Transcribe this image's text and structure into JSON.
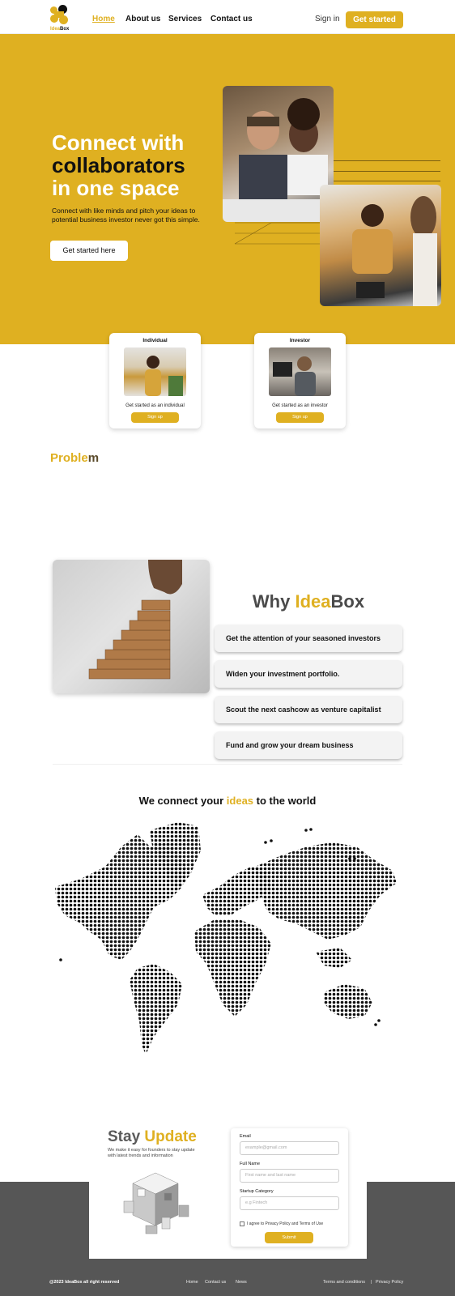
{
  "brand": {
    "name_part1": "Idea",
    "name_part2": "Box",
    "accent": "#dfb021"
  },
  "nav": {
    "links": [
      "Home",
      "About us",
      "Services",
      "Contact us"
    ],
    "signin": "Sign in",
    "cta": "Get started"
  },
  "hero": {
    "title_line1": "Connect with",
    "title_line2": "collaborators",
    "title_line3": "in one space",
    "subtitle": "Connect with like minds and pitch your ideas to potential business investor never got this simple.",
    "cta": "Get started here"
  },
  "cards": [
    {
      "title": "Individual",
      "desc": "Get started as an individual",
      "button": "Sign up"
    },
    {
      "title": "Investor",
      "desc": "Get started as an investor",
      "button": "Sign up"
    }
  ],
  "problem": {
    "part1": "Proble",
    "part2": "m"
  },
  "why": {
    "title_part1": "Why ",
    "title_part2": "Idea",
    "title_part3": "Box",
    "items": [
      "Get the attention of your seasoned investors",
      "Widen your investment portfolio.",
      "Scout the next cashcow as venture capitalist",
      "Fund and grow your dream business"
    ]
  },
  "connect": {
    "part1": "We connect your ",
    "part2": "ideas",
    "part3": " to the world"
  },
  "stay": {
    "title_part1": "Stay ",
    "title_part2": "Update",
    "subtitle": "We make it easy for founders to stay update with latest trends and information",
    "form": {
      "email_label": "Email",
      "email_placeholder": "example@gmail.com",
      "name_label": "Full Name",
      "name_placeholder": "First name and last name",
      "category_label": "Startup Category",
      "category_placeholder": "e.g Fintech",
      "agree": "I agree to Privacy Policy and Terms of Use",
      "submit": "Submit"
    }
  },
  "footer": {
    "copyright": "@2023 IdeaBox all right reserved",
    "links": [
      "Home",
      "Contact us",
      "News"
    ],
    "terms": "Terms and conditions",
    "separator": "|",
    "privacy": "Privacy Policy"
  }
}
